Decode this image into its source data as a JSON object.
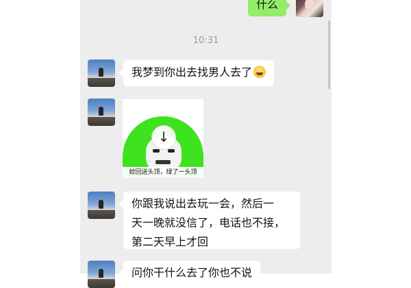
{
  "chat": {
    "timestamp": "10:31",
    "self_message": "什么",
    "messages": [
      {
        "text": "我梦到你出去找男人去了",
        "emoji": "grinning-sweat-emoji"
      },
      {
        "sticker_caption": "蚊回送头顶，绿了一头顶"
      },
      {
        "lines": [
          "你跟我说出去玩一会，然后一",
          "天一晚就没信了，电话也不接，",
          "第二天早上才回"
        ]
      },
      {
        "text": "问你干什么去了你也不说"
      }
    ]
  },
  "colors": {
    "chat_background": "#ededed",
    "self_bubble": "#95ec69",
    "other_bubble": "#ffffff",
    "sticker_green": "#3fe21f"
  },
  "icons": {
    "sticker_download": "download-arrow-icon"
  }
}
